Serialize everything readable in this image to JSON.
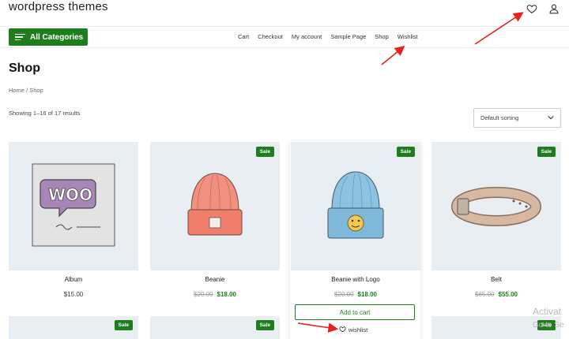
{
  "header": {
    "site_title": "wordpress themes",
    "icons": [
      "heart-icon",
      "user-icon"
    ]
  },
  "all_categories": {
    "label": "All Categories"
  },
  "nav": {
    "items": [
      "Cart",
      "Checkout",
      "My account",
      "Sample Page",
      "Shop",
      "Wishlist"
    ]
  },
  "page": {
    "title": "Shop",
    "breadcrumb": "Home / Shop",
    "result_count": "Showing 1–16 of 17 results",
    "sorting": "Default sorting"
  },
  "products": [
    {
      "name": "Album",
      "price": "$15.00",
      "sale": ""
    },
    {
      "name": "Beanie",
      "old_price": "$20.00",
      "price": "$18.00",
      "sale": "Sale"
    },
    {
      "name": "Beanie with Logo",
      "old_price": "$20.00",
      "price": "$18.00",
      "sale": "Sale",
      "add_to_cart": "Add to cart",
      "wishlist": "wishlist"
    },
    {
      "name": "Belt",
      "old_price": "$65.00",
      "price": "$55.00",
      "sale": "Sale"
    }
  ],
  "second_row": {
    "sale_label": "Sale"
  },
  "watermark": {
    "line1": "Activat",
    "line2": "Go to Se"
  },
  "colors": {
    "accent": "#1e7e1e",
    "arrow": "#e8221c",
    "tile_bg": "#e9eef2"
  }
}
